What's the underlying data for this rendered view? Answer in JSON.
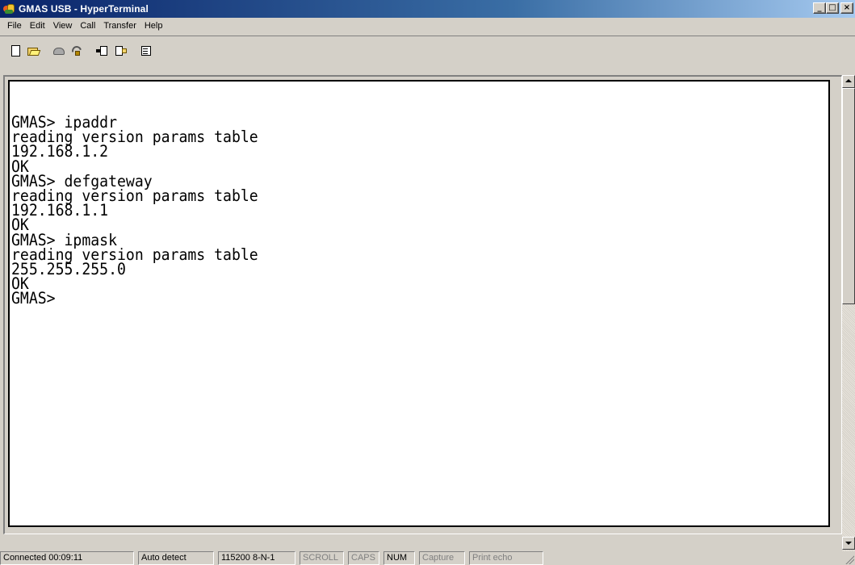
{
  "window": {
    "title": "GMAS USB - HyperTerminal",
    "minimize_glyph": "_",
    "maximize_glyph": "□",
    "close_glyph": "×"
  },
  "menu": [
    "File",
    "Edit",
    "View",
    "Call",
    "Transfer",
    "Help"
  ],
  "toolbar": {
    "buttons": [
      "new-connection-icon",
      "open-icon",
      "call-icon",
      "disconnect-icon",
      "send-icon",
      "receive-icon",
      "properties-icon"
    ]
  },
  "terminal": {
    "lines": [
      "GMAS> ipaddr",
      "reading version params table",
      "192.168.1.2",
      "OK",
      "GMAS> defgateway",
      "reading version params table",
      "192.168.1.1",
      "OK",
      "GMAS> ipmask",
      "reading version params table",
      "255.255.255.0",
      "OK",
      "GMAS>"
    ]
  },
  "statusbar": {
    "connected": "Connected 00:09:11",
    "detect": "Auto detect",
    "settings": "115200 8-N-1",
    "scroll": "SCROLL",
    "caps": "CAPS",
    "num": "NUM",
    "capture": "Capture",
    "print_echo": "Print echo"
  }
}
